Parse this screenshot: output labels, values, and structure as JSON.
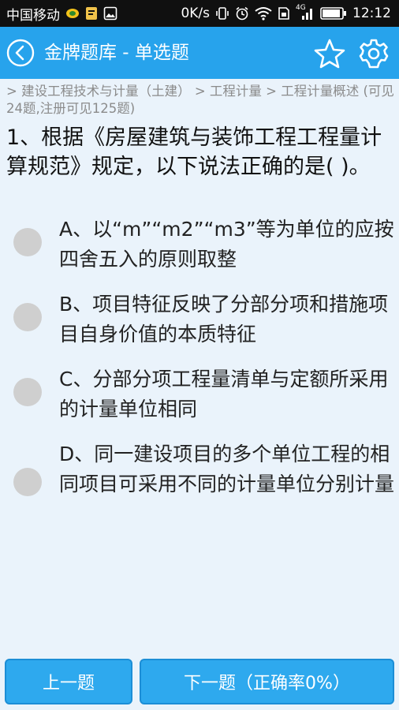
{
  "status_bar": {
    "carrier": "中国移动",
    "speed": "0K/s",
    "network": "4G",
    "time": "12:12"
  },
  "header": {
    "title": "金牌题库 - 单选题"
  },
  "breadcrumb": {
    "text": "> 建设工程技术与计量（土建） > 工程计量 > 工程计量概述 (可见24题,注册可见125题)"
  },
  "question": {
    "text": "1、根据《房屋建筑与装饰工程工程量计算规范》规定，以下说法正确的是( )。",
    "options": [
      "A、以“m”“m2”“m3”等为单位的应按四舍五入的原则取整",
      "B、项目特征反映了分部分项和措施项目自身价值的本质特征",
      "C、分部分项工程量清单与定额所采用的计量单位相同",
      "D、同一建设项目的多个单位工程的相同项目可采用不同的计量单位分别计量"
    ]
  },
  "footer": {
    "prev_label": "上一题",
    "next_label": "下一题（正确率0%）"
  },
  "colors": {
    "header": "#27a3ec",
    "button": "#2ea9ee",
    "background": "#eaf3fb",
    "radio": "#cfcfcf"
  },
  "icons": [
    "back-icon",
    "star-icon",
    "gear-icon"
  ]
}
